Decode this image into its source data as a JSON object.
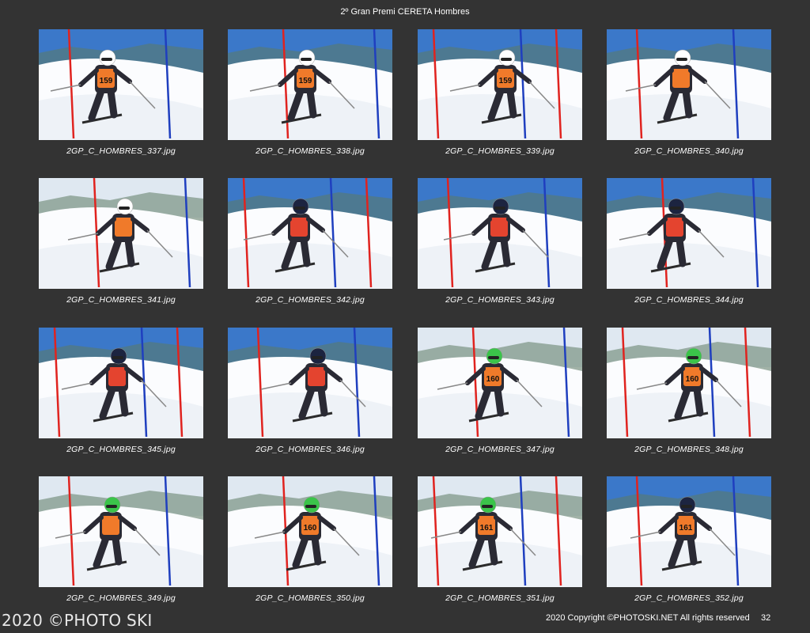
{
  "page": {
    "title": "2º Gran Premi CERETA Hombres",
    "watermark": "2020 ©PHOTO SKI",
    "copyright": "2020 Copyright ©PHOTOSKI.NET All rights reserved",
    "page_number": "32"
  },
  "photos": [
    {
      "filename": "2GP_C_HOMBRES_337.jpg",
      "bib": "159",
      "bib_color": "#f07a2a",
      "helmet_color": "#ffffff",
      "sky": true
    },
    {
      "filename": "2GP_C_HOMBRES_338.jpg",
      "bib": "159",
      "bib_color": "#f07a2a",
      "helmet_color": "#ffffff",
      "sky": true
    },
    {
      "filename": "2GP_C_HOMBRES_339.jpg",
      "bib": "159",
      "bib_color": "#f07a2a",
      "helmet_color": "#ffffff",
      "sky": true
    },
    {
      "filename": "2GP_C_HOMBRES_340.jpg",
      "bib": "",
      "bib_color": "#f07a2a",
      "helmet_color": "#ffffff",
      "sky": true
    },
    {
      "filename": "2GP_C_HOMBRES_341.jpg",
      "bib": "",
      "bib_color": "#f07a2a",
      "helmet_color": "#ffffff",
      "sky": false
    },
    {
      "filename": "2GP_C_HOMBRES_342.jpg",
      "bib": "",
      "bib_color": "#e4442f",
      "helmet_color": "#1c2440",
      "sky": true
    },
    {
      "filename": "2GP_C_HOMBRES_343.jpg",
      "bib": "",
      "bib_color": "#e4442f",
      "helmet_color": "#1c2440",
      "sky": true
    },
    {
      "filename": "2GP_C_HOMBRES_344.jpg",
      "bib": "",
      "bib_color": "#e4442f",
      "helmet_color": "#1c2440",
      "sky": true
    },
    {
      "filename": "2GP_C_HOMBRES_345.jpg",
      "bib": "",
      "bib_color": "#e4442f",
      "helmet_color": "#1c2440",
      "sky": true
    },
    {
      "filename": "2GP_C_HOMBRES_346.jpg",
      "bib": "",
      "bib_color": "#e4442f",
      "helmet_color": "#1c2440",
      "sky": true
    },
    {
      "filename": "2GP_C_HOMBRES_347.jpg",
      "bib": "160",
      "bib_color": "#f07a2a",
      "helmet_color": "#3bc44a",
      "sky": false
    },
    {
      "filename": "2GP_C_HOMBRES_348.jpg",
      "bib": "160",
      "bib_color": "#f07a2a",
      "helmet_color": "#3bc44a",
      "sky": false
    },
    {
      "filename": "2GP_C_HOMBRES_349.jpg",
      "bib": "",
      "bib_color": "#f07a2a",
      "helmet_color": "#3bc44a",
      "sky": false
    },
    {
      "filename": "2GP_C_HOMBRES_350.jpg",
      "bib": "160",
      "bib_color": "#f07a2a",
      "helmet_color": "#3bc44a",
      "sky": false
    },
    {
      "filename": "2GP_C_HOMBRES_351.jpg",
      "bib": "161",
      "bib_color": "#f07a2a",
      "helmet_color": "#3bc44a",
      "sky": false
    },
    {
      "filename": "2GP_C_HOMBRES_352.jpg",
      "bib": "161",
      "bib_color": "#f07a2a",
      "helmet_color": "#1c2440",
      "sky": true
    }
  ]
}
